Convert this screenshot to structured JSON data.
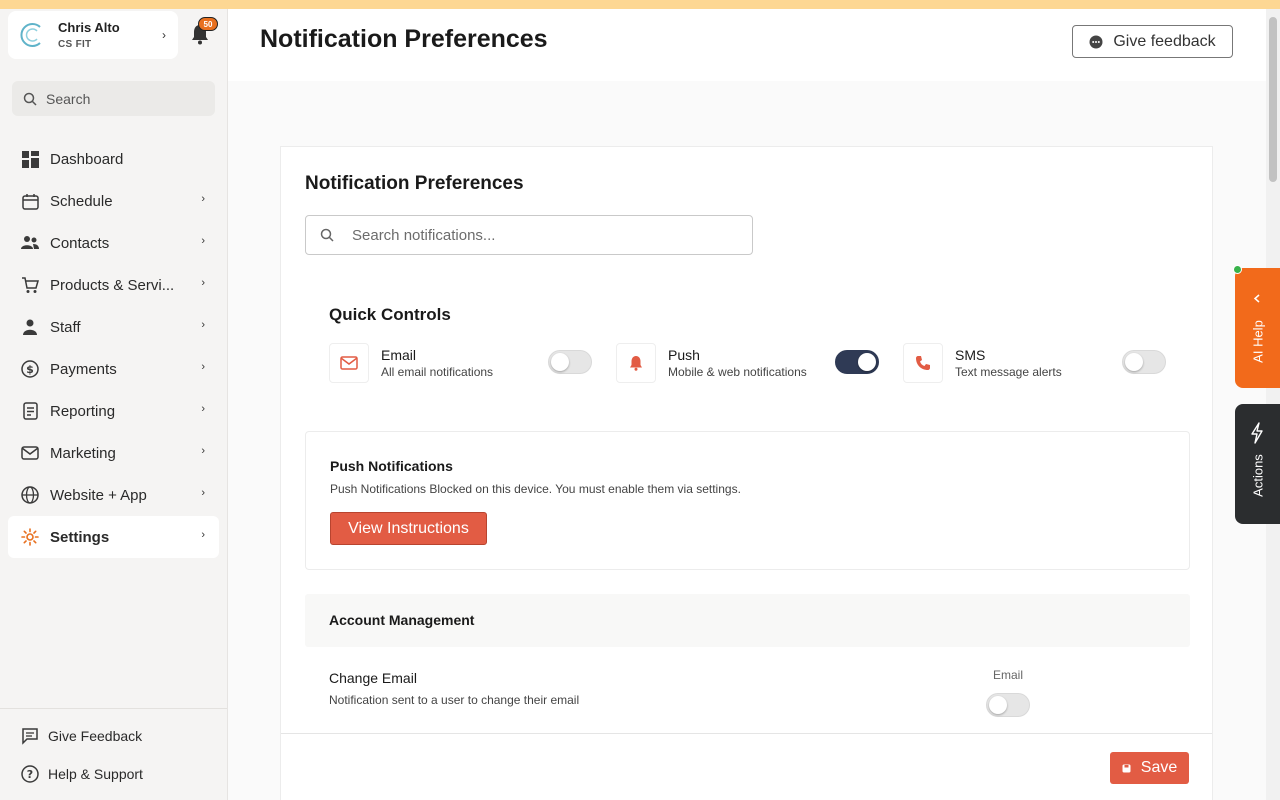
{
  "account": {
    "name": "Chris Alto",
    "org": "CS FIT",
    "notification_count": "50"
  },
  "sidebar": {
    "search_label": "Search",
    "items": [
      {
        "label": "Dashboard"
      },
      {
        "label": "Schedule"
      },
      {
        "label": "Contacts"
      },
      {
        "label": "Products & Servi..."
      },
      {
        "label": "Staff"
      },
      {
        "label": "Payments"
      },
      {
        "label": "Reporting"
      },
      {
        "label": "Marketing"
      },
      {
        "label": "Website + App"
      },
      {
        "label": "Settings"
      }
    ],
    "bottom": {
      "feedback": "Give Feedback",
      "help": "Help & Support"
    }
  },
  "header": {
    "title": "Notification Preferences",
    "feedback_label": "Give feedback"
  },
  "card": {
    "title": "Notification Preferences",
    "search_placeholder": "Search notifications...",
    "quick_controls": {
      "title": "Quick Controls",
      "items": [
        {
          "title": "Email",
          "subtitle": "All email notifications",
          "enabled": false
        },
        {
          "title": "Push",
          "subtitle": "Mobile & web notifications",
          "enabled": true
        },
        {
          "title": "SMS",
          "subtitle": "Text message alerts",
          "enabled": false
        }
      ]
    },
    "push": {
      "title": "Push Notifications",
      "description": "Push Notifications Blocked on this device. You must enable them via settings.",
      "button": "View Instructions"
    },
    "account_management": {
      "title": "Account Management",
      "column_label": "Email",
      "rows": [
        {
          "title": "Change Email",
          "description": "Notification sent to a user to change their email",
          "email_enabled": false
        }
      ]
    },
    "save_label": "Save"
  },
  "right_tabs": {
    "ai_help": "AI Help",
    "actions": "Actions"
  },
  "colors": {
    "accent": "#e25c44",
    "orange": "#f26a1b",
    "toggle_on": "#2f3a55"
  }
}
